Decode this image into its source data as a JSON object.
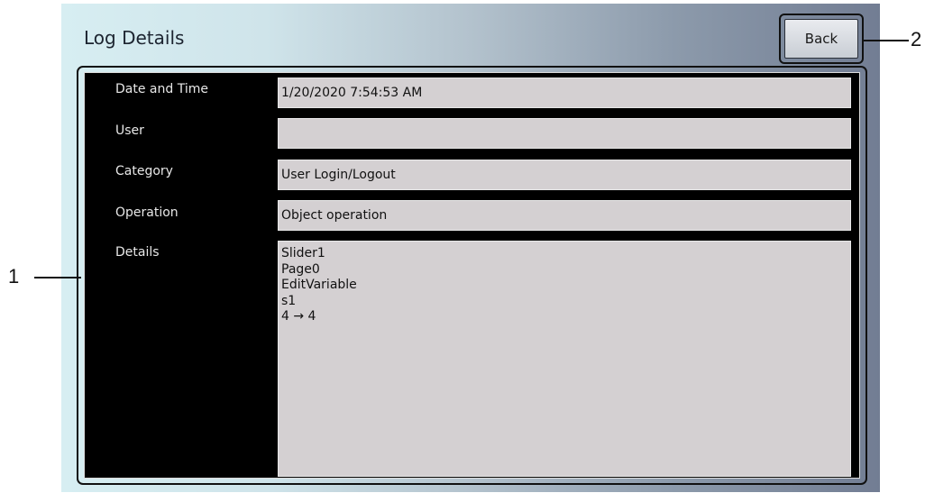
{
  "window": {
    "title": "Log Details",
    "back_label": "Back"
  },
  "fields": [
    {
      "label": "Date and Time",
      "value": "1/20/2020 7:54:53 AM"
    },
    {
      "label": "User",
      "value": ""
    },
    {
      "label": "Category",
      "value": "User Login/Logout"
    },
    {
      "label": "Operation",
      "value": "Object operation"
    }
  ],
  "details": {
    "label": "Details",
    "value": "Slider1\nPage0\nEditVariable\ns1\n4 → 4"
  },
  "callouts": {
    "panel": "1",
    "back": "2"
  }
}
